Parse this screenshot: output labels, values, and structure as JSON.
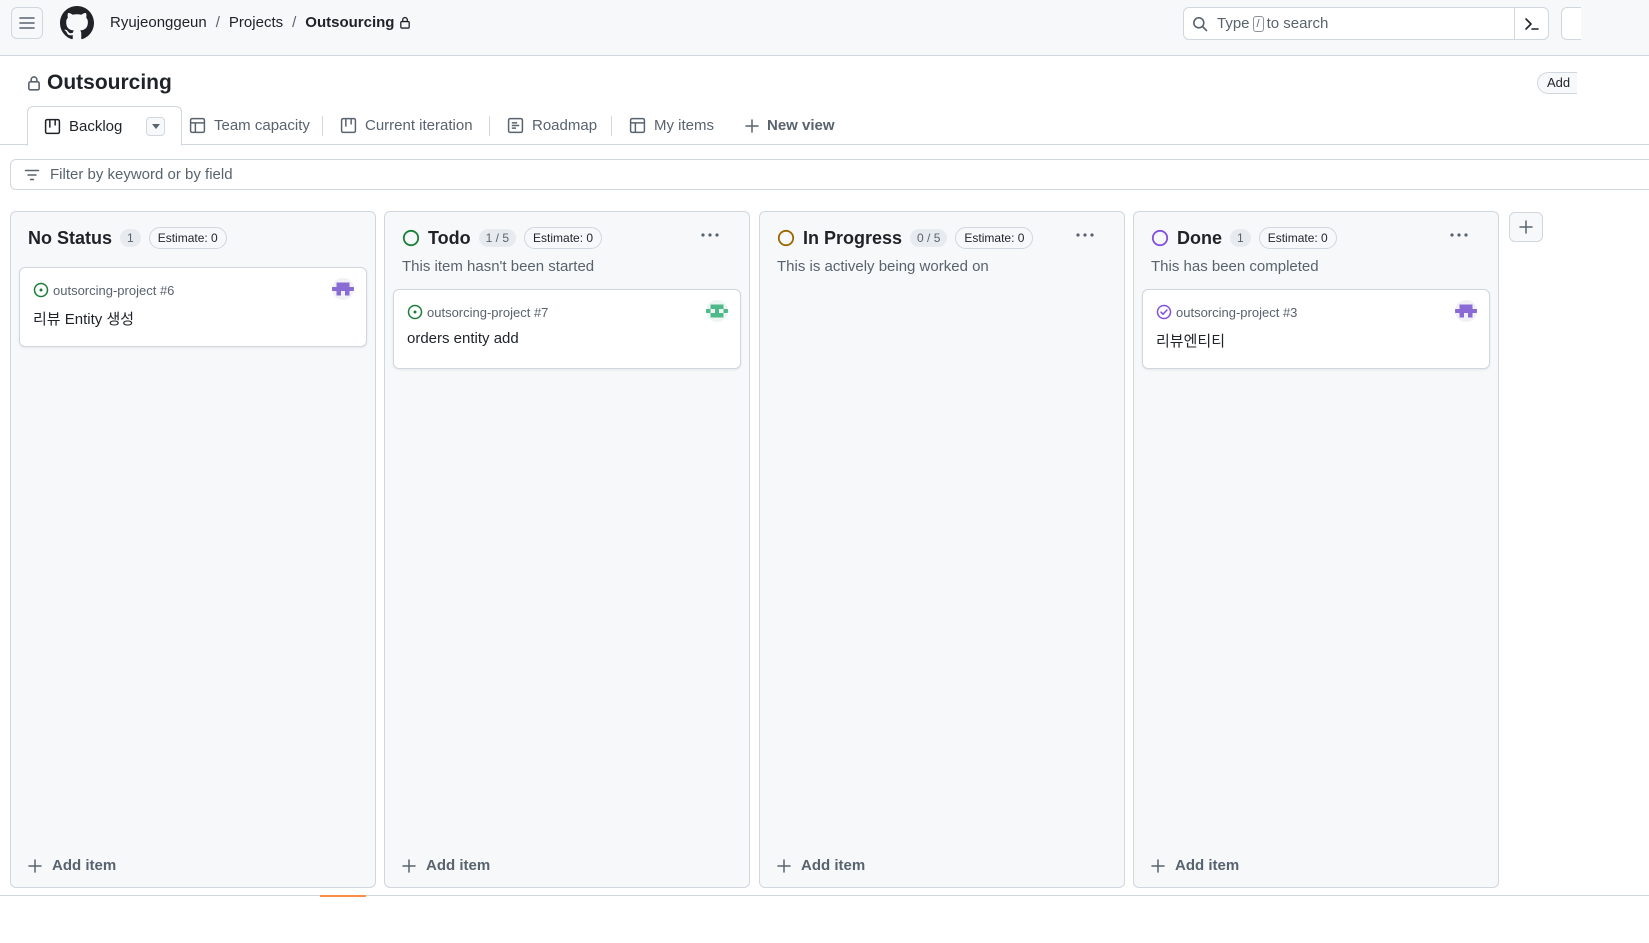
{
  "header": {
    "breadcrumbs": [
      "Ryujeonggeun",
      "Projects",
      "Outsourcing"
    ],
    "search_pre": "Type",
    "search_key": "/",
    "search_post": "to search"
  },
  "project": {
    "title": "Outsourcing",
    "add_label": "Add"
  },
  "views": {
    "tabs": [
      "Backlog",
      "Team capacity",
      "Current iteration",
      "Roadmap",
      "My items"
    ],
    "new_view": "New view"
  },
  "filter": {
    "placeholder": "Filter by keyword or by field"
  },
  "columns": [
    {
      "name": "No Status",
      "count": "1",
      "estimate": "Estimate: 0",
      "description": "",
      "status_color": "",
      "cards": [
        {
          "ref": "outsorcing-project #6",
          "title": "리뷰 Entity 생성",
          "state": "open",
          "avatar": "purple"
        }
      ],
      "add_item": "Add item"
    },
    {
      "name": "Todo",
      "count": "1 / 5",
      "estimate": "Estimate: 0",
      "description": "This item hasn't been started",
      "status_color": "#1a7f37",
      "cards": [
        {
          "ref": "outsorcing-project #7",
          "title": "orders entity add",
          "state": "open",
          "avatar": "green"
        }
      ],
      "add_item": "Add item"
    },
    {
      "name": "In Progress",
      "count": "0 / 5",
      "estimate": "Estimate: 0",
      "description": "This is actively being worked on",
      "status_color": "#9a6700",
      "cards": [],
      "add_item": "Add item"
    },
    {
      "name": "Done",
      "count": "1",
      "estimate": "Estimate: 0",
      "description": "This has been completed",
      "status_color": "#8250df",
      "cards": [
        {
          "ref": "outsorcing-project #3",
          "title": "리뷰엔티티",
          "state": "done",
          "avatar": "purple"
        }
      ],
      "add_item": "Add item"
    }
  ],
  "colors": {
    "open": "#1a7f37",
    "in_progress": "#9a6700",
    "done": "#8250df"
  }
}
